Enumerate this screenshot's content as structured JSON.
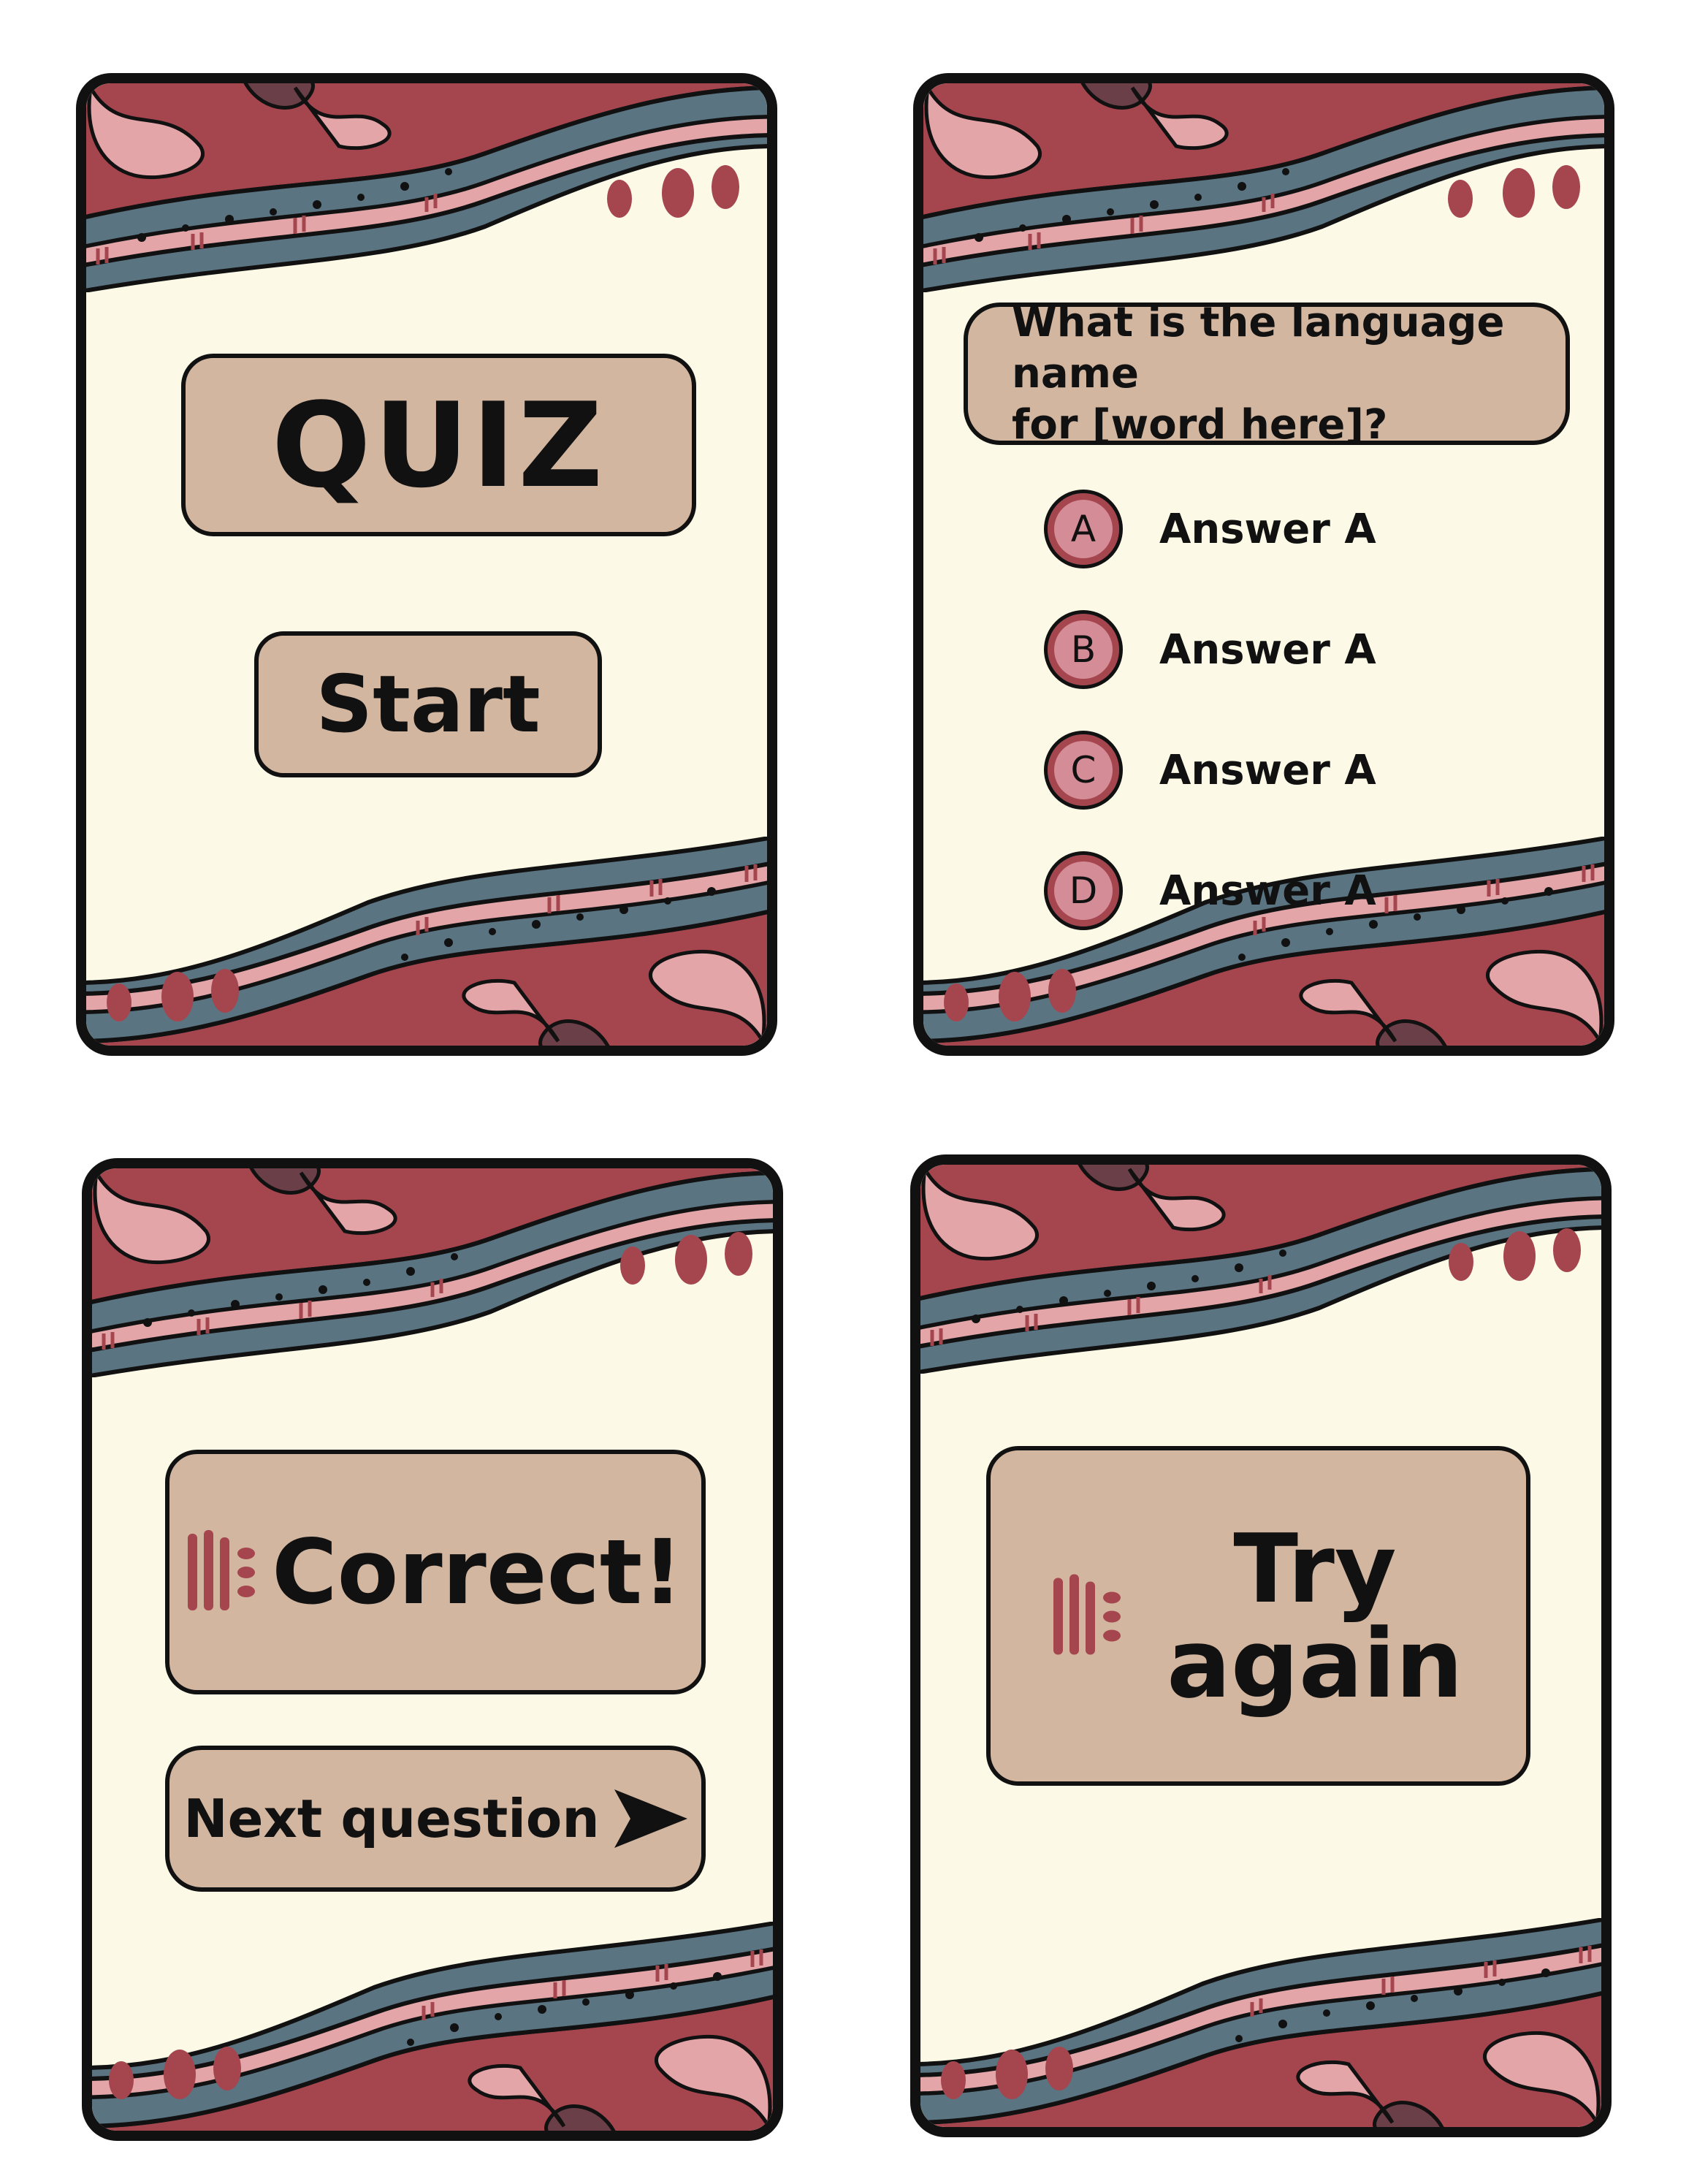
{
  "cards": {
    "title_card": {
      "title": "QUIZ",
      "start_label": "Start"
    },
    "question_card": {
      "question_line1": "What is the language name",
      "question_line2": "for [word here]?",
      "options": [
        {
          "letter": "A",
          "label": "Answer A"
        },
        {
          "letter": "B",
          "label": "Answer A"
        },
        {
          "letter": "C",
          "label": "Answer A"
        },
        {
          "letter": "D",
          "label": "Answer A"
        }
      ]
    },
    "correct_card": {
      "result": "Correct!",
      "next_label": "Next question"
    },
    "try_again_card": {
      "line1": "Try",
      "line2": "again"
    }
  },
  "colors": {
    "card_background": "#fcfae6",
    "button_fill": "#d3b6a0",
    "accent_maroon": "#a5464f",
    "accent_pink": "#e3a5a8",
    "accent_slate": "#5a7482",
    "outline": "#111111"
  },
  "icons": [
    "corner-pattern-icon",
    "three-dots-icon",
    "hand-mark-icon",
    "arrow-right-icon"
  ]
}
